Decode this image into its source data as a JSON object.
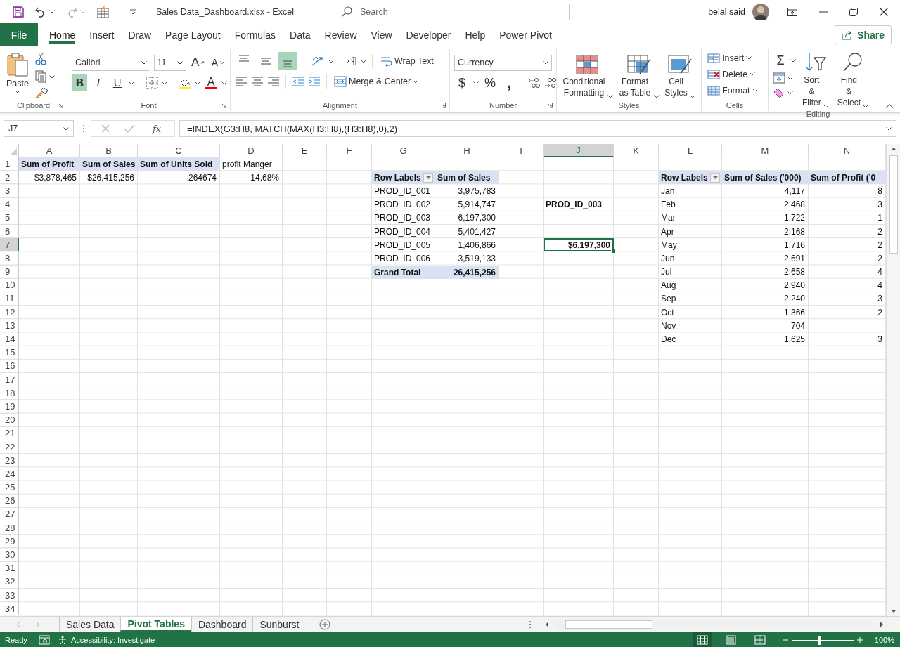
{
  "title_bar": {
    "title": "Sales Data_Dashboard.xlsx  -  Excel",
    "search": {
      "placeholder": "Search"
    },
    "user": "belal said"
  },
  "menu_tabs": [
    {
      "label": "File",
      "kind": "file",
      "selected": false
    },
    {
      "label": "Home",
      "kind": "tab",
      "selected": true
    },
    {
      "label": "Insert",
      "kind": "tab",
      "selected": false
    },
    {
      "label": "Draw",
      "kind": "tab",
      "selected": false
    },
    {
      "label": "Page Layout",
      "kind": "tab",
      "selected": false
    },
    {
      "label": "Formulas",
      "kind": "tab",
      "selected": false
    },
    {
      "label": "Data",
      "kind": "tab",
      "selected": false
    },
    {
      "label": "Review",
      "kind": "tab",
      "selected": false
    },
    {
      "label": "View",
      "kind": "tab",
      "selected": false
    },
    {
      "label": "Developer",
      "kind": "tab",
      "selected": false
    },
    {
      "label": "Help",
      "kind": "tab",
      "selected": false
    },
    {
      "label": "Power Pivot",
      "kind": "tab",
      "selected": false
    }
  ],
  "share_button": "Share",
  "ribbon": {
    "clipboard": {
      "label": "Clipboard",
      "paste": "Paste"
    },
    "font": {
      "label": "Font",
      "font_name": "Calibri",
      "font_size": "11",
      "grow": "A",
      "shrink": "A",
      "font_color": "A",
      "styles": [
        {
          "label": "B",
          "kind": "bold",
          "selected": true
        },
        {
          "label": "I",
          "kind": "italic",
          "selected": false
        },
        {
          "label": "U",
          "kind": "underline",
          "selected": false
        }
      ]
    },
    "alignment": {
      "label": "Alignment",
      "wrap_text": "Wrap Text",
      "merge_center": "Merge & Center",
      "vertical": [
        {
          "kind": "top",
          "selected": false
        },
        {
          "kind": "middle",
          "selected": false
        },
        {
          "kind": "bottom",
          "selected": true
        }
      ]
    },
    "number": {
      "label": "Number",
      "format": "Currency",
      "symbols": [
        "$",
        "%",
        ","
      ]
    },
    "styles": {
      "label": "Styles",
      "buttons": [
        "Conditional Formatting",
        "Format as Table",
        "Cell Styles"
      ]
    },
    "cells": {
      "label": "Cells",
      "buttons": [
        "Insert",
        "Delete",
        "Format"
      ]
    },
    "editing": {
      "label": "Editing",
      "sum": "Σ",
      "buttons": [
        "Sort & Filter",
        "Find & Select"
      ]
    }
  },
  "formula_bar": {
    "name_box": "J7",
    "function_label": "fx",
    "formula": "=INDEX(G3:H8, MATCH(MAX(H3:H8),(H3:H8),0),2)"
  },
  "columns": [
    {
      "label": "A",
      "selected": false
    },
    {
      "label": "B",
      "selected": false
    },
    {
      "label": "C",
      "selected": false
    },
    {
      "label": "D",
      "selected": false
    },
    {
      "label": "E",
      "selected": false
    },
    {
      "label": "F",
      "selected": false
    },
    {
      "label": "G",
      "selected": false
    },
    {
      "label": "H",
      "selected": false
    },
    {
      "label": "I",
      "selected": false
    },
    {
      "label": "J",
      "selected": true
    },
    {
      "label": "K",
      "selected": false
    },
    {
      "label": "L",
      "selected": false
    },
    {
      "label": "M",
      "selected": false
    },
    {
      "label": "N",
      "selected": false
    }
  ],
  "rows": [
    {
      "number": "1",
      "selected": false,
      "cells": [
        {
          "text": "Sum of Profit",
          "kind": "header"
        },
        {
          "text": "Sum of Sales",
          "kind": "header"
        },
        {
          "text": "Sum of Units Sold",
          "kind": "header"
        },
        {
          "text": "profit Manger",
          "kind": "label"
        }
      ]
    },
    {
      "number": "2",
      "selected": false,
      "cells": [
        {
          "text": "$3,878,465",
          "kind": "value"
        },
        {
          "text": "$26,415,256",
          "kind": "value"
        },
        {
          "text": "264674",
          "kind": "value"
        },
        {
          "text": "14.68%",
          "kind": "value"
        },
        null,
        null,
        {
          "text": "Row Labels",
          "kind": "header_filter"
        },
        {
          "text": "Sum of Sales",
          "kind": "header"
        },
        null,
        null,
        null,
        {
          "text": "Row Labels",
          "kind": "header_filter"
        },
        {
          "text": "Sum of Sales ('000)",
          "kind": "header"
        },
        {
          "text": "Sum of Profit ('0",
          "kind": "header"
        }
      ]
    },
    {
      "number": "3",
      "selected": false,
      "cells": [
        null,
        null,
        null,
        null,
        null,
        null,
        {
          "text": "PROD_ID_001",
          "kind": "label"
        },
        {
          "text": "3,975,783",
          "kind": "value"
        },
        null,
        null,
        null,
        {
          "text": "Jan",
          "kind": "label"
        },
        {
          "text": "4,117",
          "kind": "value"
        },
        {
          "text": "8",
          "kind": "value"
        }
      ]
    },
    {
      "number": "4",
      "selected": false,
      "cells": [
        null,
        null,
        null,
        null,
        null,
        null,
        {
          "text": "PROD_ID_002",
          "kind": "label"
        },
        {
          "text": "5,914,747",
          "kind": "value"
        },
        null,
        {
          "text": "PROD_ID_003",
          "kind": "result"
        },
        null,
        {
          "text": "Feb",
          "kind": "label"
        },
        {
          "text": "2,468",
          "kind": "value"
        },
        {
          "text": "3",
          "kind": "value"
        }
      ]
    },
    {
      "number": "5",
      "selected": false,
      "cells": [
        null,
        null,
        null,
        null,
        null,
        null,
        {
          "text": "PROD_ID_003",
          "kind": "label"
        },
        {
          "text": "6,197,300",
          "kind": "value"
        },
        null,
        null,
        null,
        {
          "text": "Mar",
          "kind": "label"
        },
        {
          "text": "1,722",
          "kind": "value"
        },
        {
          "text": "1",
          "kind": "value"
        }
      ]
    },
    {
      "number": "6",
      "selected": false,
      "cells": [
        null,
        null,
        null,
        null,
        null,
        null,
        {
          "text": "PROD_ID_004",
          "kind": "label"
        },
        {
          "text": "5,401,427",
          "kind": "value"
        },
        null,
        null,
        null,
        {
          "text": "Apr",
          "kind": "label"
        },
        {
          "text": "2,168",
          "kind": "value"
        },
        {
          "text": "2",
          "kind": "value"
        }
      ]
    },
    {
      "number": "7",
      "selected": true,
      "cells": [
        null,
        null,
        null,
        null,
        null,
        null,
        {
          "text": "PROD_ID_005",
          "kind": "label"
        },
        {
          "text": "1,406,866",
          "kind": "value"
        },
        null,
        {
          "text": "$6,197,300",
          "kind": "result_value"
        },
        null,
        {
          "text": "May",
          "kind": "label"
        },
        {
          "text": "1,716",
          "kind": "value"
        },
        {
          "text": "2",
          "kind": "value"
        }
      ]
    },
    {
      "number": "8",
      "selected": false,
      "cells": [
        null,
        null,
        null,
        null,
        null,
        null,
        {
          "text": "PROD_ID_006",
          "kind": "label"
        },
        {
          "text": "3,519,133",
          "kind": "value"
        },
        null,
        null,
        null,
        {
          "text": "Jun",
          "kind": "label"
        },
        {
          "text": "2,691",
          "kind": "value"
        },
        {
          "text": "2",
          "kind": "value"
        }
      ]
    },
    {
      "number": "9",
      "selected": false,
      "cells": [
        null,
        null,
        null,
        null,
        null,
        null,
        {
          "text": "Grand Total",
          "kind": "total_label"
        },
        {
          "text": "26,415,256",
          "kind": "total_value"
        },
        null,
        null,
        null,
        {
          "text": "Jul",
          "kind": "label"
        },
        {
          "text": "2,658",
          "kind": "value"
        },
        {
          "text": "4",
          "kind": "value"
        }
      ]
    },
    {
      "number": "10",
      "selected": false,
      "cells": [
        null,
        null,
        null,
        null,
        null,
        null,
        null,
        null,
        null,
        null,
        null,
        {
          "text": "Aug",
          "kind": "label"
        },
        {
          "text": "2,940",
          "kind": "value"
        },
        {
          "text": "4",
          "kind": "value"
        }
      ]
    },
    {
      "number": "11",
      "selected": false,
      "cells": [
        null,
        null,
        null,
        null,
        null,
        null,
        null,
        null,
        null,
        null,
        null,
        {
          "text": "Sep",
          "kind": "label"
        },
        {
          "text": "2,240",
          "kind": "value"
        },
        {
          "text": "3",
          "kind": "value"
        }
      ]
    },
    {
      "number": "12",
      "selected": false,
      "cells": [
        null,
        null,
        null,
        null,
        null,
        null,
        null,
        null,
        null,
        null,
        null,
        {
          "text": "Oct",
          "kind": "label"
        },
        {
          "text": "1,366",
          "kind": "value"
        },
        {
          "text": "2",
          "kind": "value"
        }
      ]
    },
    {
      "number": "13",
      "selected": false,
      "cells": [
        null,
        null,
        null,
        null,
        null,
        null,
        null,
        null,
        null,
        null,
        null,
        {
          "text": "Nov",
          "kind": "label"
        },
        {
          "text": "704",
          "kind": "value"
        }
      ]
    },
    {
      "number": "14",
      "selected": false,
      "cells": [
        null,
        null,
        null,
        null,
        null,
        null,
        null,
        null,
        null,
        null,
        null,
        {
          "text": "Dec",
          "kind": "label"
        },
        {
          "text": "1,625",
          "kind": "value"
        },
        {
          "text": "3",
          "kind": "value"
        }
      ]
    },
    {
      "number": "15",
      "selected": false
    },
    {
      "number": "16",
      "selected": false
    },
    {
      "number": "17",
      "selected": false
    },
    {
      "number": "18",
      "selected": false
    },
    {
      "number": "19",
      "selected": false
    },
    {
      "number": "20",
      "selected": false
    },
    {
      "number": "21",
      "selected": false
    },
    {
      "number": "22",
      "selected": false
    },
    {
      "number": "23",
      "selected": false
    },
    {
      "number": "24",
      "selected": false
    },
    {
      "number": "25",
      "selected": false
    },
    {
      "number": "26",
      "selected": false
    },
    {
      "number": "27",
      "selected": false
    },
    {
      "number": "28",
      "selected": false
    },
    {
      "number": "29",
      "selected": false
    },
    {
      "number": "30",
      "selected": false
    },
    {
      "number": "31",
      "selected": false
    },
    {
      "number": "32",
      "selected": false
    },
    {
      "number": "33",
      "selected": false
    },
    {
      "number": "34",
      "selected": false
    }
  ],
  "sheet_tabs": [
    {
      "label": "Sales Data",
      "selected": false
    },
    {
      "label": "Pivot Tables",
      "selected": true
    },
    {
      "label": "Dashboard",
      "selected": false
    },
    {
      "label": "Sunburst",
      "selected": false
    }
  ],
  "status_bar": {
    "mode": "Ready",
    "accessibility": "Accessibility: Investigate",
    "zoom": {
      "level": 0.45,
      "reading": "100%"
    },
    "views": [
      {
        "kind": "normal",
        "selected": true
      },
      {
        "kind": "page_layout",
        "selected": false
      },
      {
        "kind": "page_break",
        "selected": false
      }
    ]
  }
}
